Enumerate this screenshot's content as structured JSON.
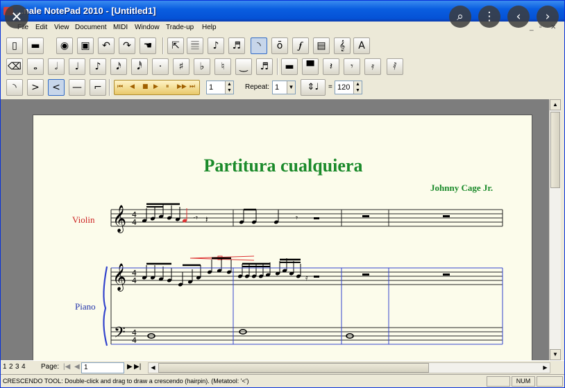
{
  "window": {
    "title": "...nale NotePad 2010 - [Untitled1]"
  },
  "overlay": {
    "close": "✕",
    "lens": "⌕",
    "more": "⋮",
    "prev": "‹",
    "next": "›"
  },
  "menu": [
    "File",
    "Edit",
    "View",
    "Document",
    "MIDI",
    "Window",
    "Trade-up",
    "Help"
  ],
  "doc_controls": {
    "minimize": "_",
    "restore": "▫",
    "close": "✕"
  },
  "toolbar1": {
    "icons": [
      {
        "name": "new-icon",
        "glyph": "▯"
      },
      {
        "name": "open-icon",
        "glyph": "▬"
      },
      {
        "name": "save-icon",
        "glyph": "◉"
      },
      {
        "name": "print-icon",
        "glyph": "▣"
      },
      {
        "name": "undo-icon",
        "glyph": "↶"
      },
      {
        "name": "redo-icon",
        "glyph": "↷"
      },
      {
        "name": "hand-icon",
        "glyph": "☚"
      },
      {
        "name": "selection-tool-icon",
        "glyph": "⇱"
      },
      {
        "name": "staff-tool-icon",
        "glyph": "𝄚"
      },
      {
        "name": "simple-entry-icon",
        "glyph": "♪"
      },
      {
        "name": "speedy-entry-icon",
        "glyph": "♬"
      },
      {
        "name": "smart-shape-icon",
        "glyph": "◝"
      },
      {
        "name": "articulation-tool-icon",
        "glyph": "ō"
      },
      {
        "name": "expression-tool-icon",
        "glyph": "𝆑"
      },
      {
        "name": "lyrics-tool-icon",
        "glyph": "▤"
      },
      {
        "name": "chord-tool-icon",
        "glyph": "𝄞"
      },
      {
        "name": "text-tool-icon",
        "glyph": "A"
      }
    ]
  },
  "toolbar2": {
    "icons": [
      {
        "name": "eraser-icon",
        "glyph": "⌫"
      },
      {
        "name": "whole-note-icon",
        "glyph": "𝅝"
      },
      {
        "name": "half-note-icon",
        "glyph": "𝅗𝅥"
      },
      {
        "name": "quarter-note-icon",
        "glyph": "♩"
      },
      {
        "name": "eighth-note-icon",
        "glyph": "♪"
      },
      {
        "name": "sixteenth-note-icon",
        "glyph": "𝅘𝅥𝅯"
      },
      {
        "name": "thirty-second-note-icon",
        "glyph": "𝅘𝅥𝅰"
      },
      {
        "name": "dot-icon",
        "glyph": "·"
      },
      {
        "name": "sharp-icon",
        "glyph": "♯"
      },
      {
        "name": "flat-icon",
        "glyph": "♭"
      },
      {
        "name": "natural-icon",
        "glyph": "♮"
      },
      {
        "name": "tie-icon",
        "glyph": "‿"
      },
      {
        "name": "tuplet-icon",
        "glyph": "♬"
      },
      {
        "name": "whole-rest-icon",
        "glyph": "▬"
      },
      {
        "name": "half-rest-icon",
        "glyph": "▀"
      },
      {
        "name": "quarter-rest-icon",
        "glyph": "𝄽"
      },
      {
        "name": "eighth-rest-icon",
        "glyph": "𝄾"
      },
      {
        "name": "sixteenth-rest-icon",
        "glyph": "𝄿"
      },
      {
        "name": "thirty-second-rest-icon",
        "glyph": "𝅀"
      }
    ]
  },
  "toolbar3": {
    "icons": [
      {
        "name": "slur-icon",
        "glyph": "◝"
      },
      {
        "name": "decrescendo-icon",
        "glyph": ">"
      },
      {
        "name": "crescendo-icon",
        "glyph": "<"
      },
      {
        "name": "line-icon",
        "glyph": "—"
      },
      {
        "name": "bend-icon",
        "glyph": "⌐"
      }
    ],
    "transport": [
      "⏮",
      "◀",
      "■",
      "▶",
      "⏸",
      "▶▶",
      "⏭"
    ],
    "measure_value": "1",
    "repeat_label": "Repeat:",
    "repeat_value": "1",
    "tempo_equals": "=",
    "tempo_value": "120"
  },
  "score": {
    "title": "Partitura cualquiera",
    "composer": "Johnny Cage Jr.",
    "instruments": [
      "Violin",
      "Piano"
    ]
  },
  "pagebar": {
    "pages": [
      "1",
      "2",
      "3",
      "4"
    ],
    "page_label": "Page:",
    "page_value": "1"
  },
  "status": {
    "text": "CRESCENDO TOOL: Double-click and drag to draw a crescendo (hairpin). (Metatool: '<')",
    "num": "NUM"
  },
  "colors": {
    "title_green": "#1a8a2a",
    "violin_red": "#cc2222",
    "piano_blue": "#2233aa"
  }
}
